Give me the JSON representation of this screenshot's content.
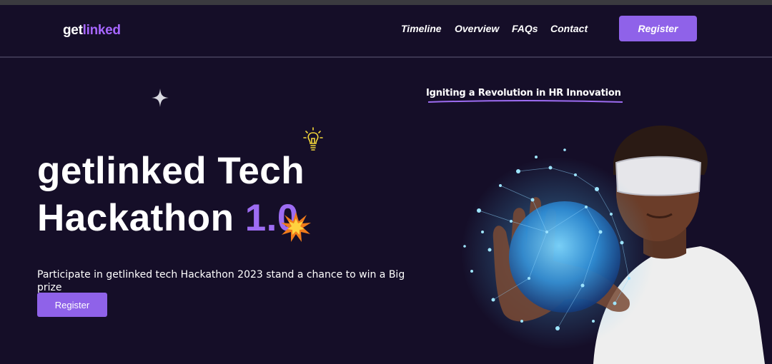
{
  "header": {
    "logo_part1": "get",
    "logo_part2": "linked",
    "nav": [
      "Timeline",
      "Overview",
      "FAQs",
      "Contact"
    ],
    "register_label": "Register"
  },
  "hero": {
    "tagline": "Igniting a Revolution in HR Innovation",
    "title_line1": "getlinked Tech",
    "title_line2_a": "Hackathon ",
    "version": "1.0",
    "description": "Participate in getlinked tech Hackathon 2023 stand a chance to win a Big prize",
    "register_label": "Register"
  },
  "icons": [
    "sparkle-star-icon",
    "lightbulb-icon",
    "burst-icon"
  ],
  "colors": {
    "background": "#150e28",
    "accent": "#8f62e9",
    "logo_accent": "#a666ff"
  }
}
